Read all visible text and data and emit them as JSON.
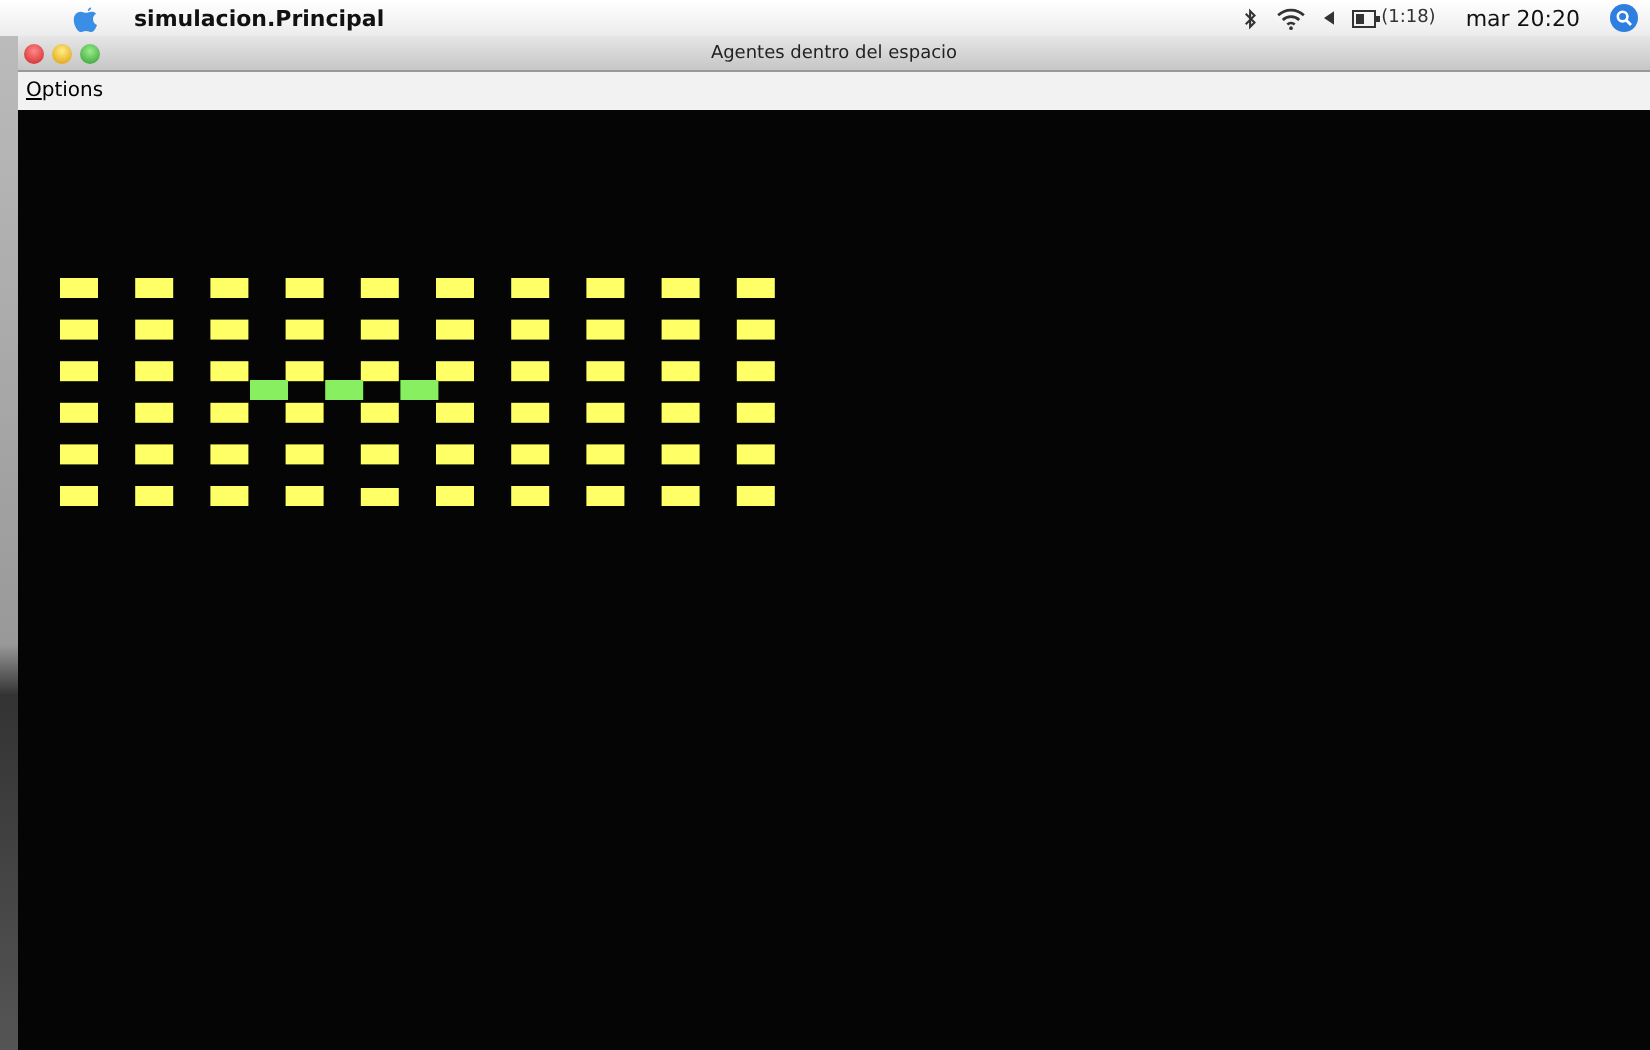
{
  "menu_bar": {
    "app_name": "simulacion.Principal",
    "battery_time": "(1:18)",
    "clock": "mar 20:20"
  },
  "window": {
    "title": "Agentes dentro del espacio",
    "menu": [
      "Options"
    ]
  }
}
